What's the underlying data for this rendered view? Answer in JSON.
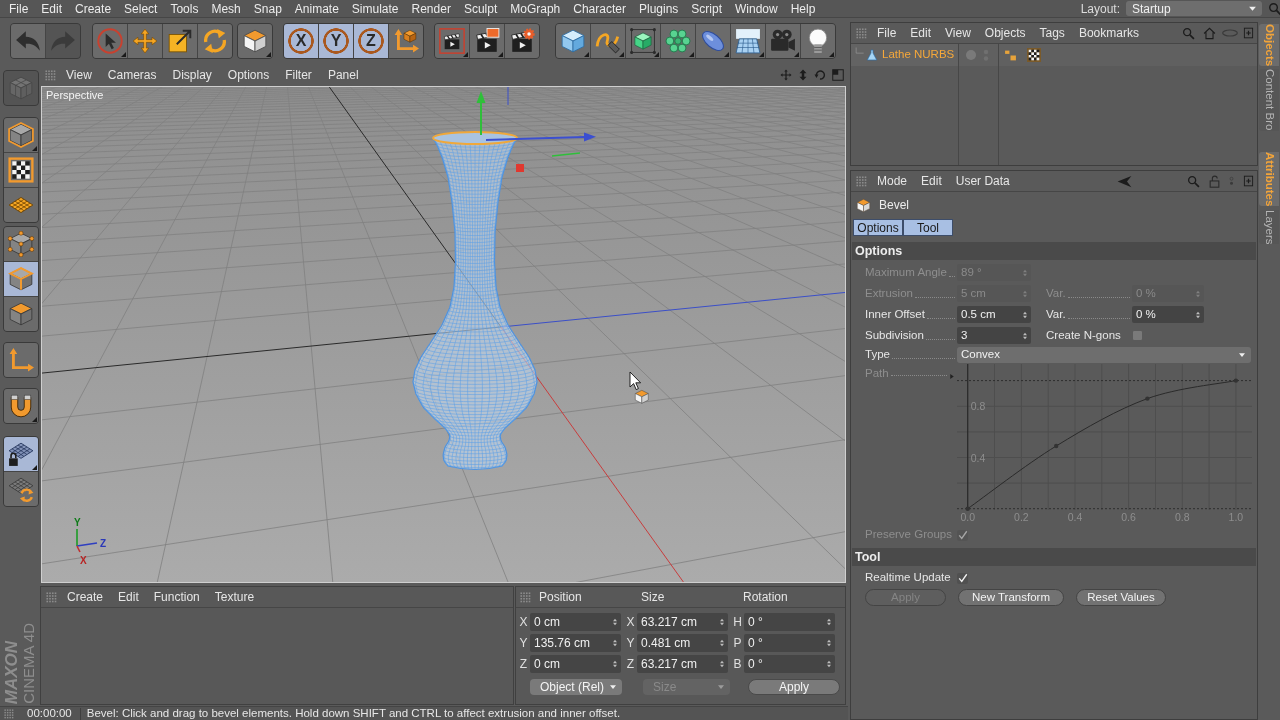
{
  "menu_bar": {
    "items": [
      "File",
      "Edit",
      "Create",
      "Select",
      "Tools",
      "Mesh",
      "Snap",
      "Animate",
      "Simulate",
      "Render",
      "Sculpt",
      "MoGraph",
      "Character",
      "Plugins",
      "Script",
      "Window",
      "Help"
    ],
    "layout_label": "Layout:",
    "layout_value": "Startup"
  },
  "toolbar": {
    "groups": [
      [
        {
          "kind": "undo",
          "on": false,
          "disabled": false,
          "submenu": false
        },
        {
          "kind": "redo",
          "on": false,
          "disabled": true,
          "submenu": false
        }
      ],
      [
        {
          "kind": "live-selection",
          "on": false,
          "disabled": false,
          "submenu": true
        },
        {
          "kind": "move",
          "on": false,
          "disabled": false,
          "submenu": false
        },
        {
          "kind": "scale",
          "on": false,
          "disabled": false,
          "submenu": false
        },
        {
          "kind": "rotate",
          "on": false,
          "disabled": false,
          "submenu": false
        }
      ],
      [
        {
          "kind": "last-tool",
          "on": false,
          "disabled": false,
          "submenu": true
        }
      ],
      [
        {
          "kind": "axis-lock",
          "label": "X",
          "on": true,
          "disabled": false,
          "submenu": false
        },
        {
          "kind": "axis-lock",
          "label": "Y",
          "on": true,
          "disabled": false,
          "submenu": false
        },
        {
          "kind": "axis-lock",
          "label": "Z",
          "on": true,
          "disabled": false,
          "submenu": false
        },
        {
          "kind": "coordinate-system",
          "on": false,
          "disabled": false,
          "submenu": false
        }
      ],
      [
        {
          "kind": "render-view",
          "on": false,
          "disabled": false,
          "submenu": true
        },
        {
          "kind": "render-viewer",
          "on": false,
          "disabled": false,
          "submenu": true
        },
        {
          "kind": "render-settings",
          "on": false,
          "disabled": false,
          "submenu": false
        }
      ],
      [
        {
          "kind": "cube",
          "on": false,
          "disabled": false,
          "submenu": true
        },
        {
          "kind": "pen",
          "on": false,
          "disabled": false,
          "submenu": true
        },
        {
          "kind": "subdivision",
          "on": false,
          "disabled": false,
          "submenu": true
        },
        {
          "kind": "array",
          "on": false,
          "disabled": false,
          "submenu": true
        },
        {
          "kind": "deformer",
          "on": false,
          "disabled": false,
          "submenu": true
        },
        {
          "kind": "floor",
          "on": false,
          "disabled": false,
          "submenu": true
        },
        {
          "kind": "camera",
          "on": false,
          "disabled": false,
          "submenu": true
        },
        {
          "kind": "light",
          "on": false,
          "disabled": false,
          "submenu": true
        }
      ]
    ]
  },
  "mode_toolbar": {
    "groups": [
      [
        {
          "kind": "make-editable",
          "on": false,
          "disabled": true,
          "submenu": false
        }
      ],
      [
        {
          "kind": "model",
          "on": false,
          "disabled": false,
          "submenu": true
        },
        {
          "kind": "texture",
          "on": false,
          "disabled": false,
          "submenu": false
        },
        {
          "kind": "workplane",
          "on": false,
          "disabled": false,
          "submenu": false
        }
      ],
      [
        {
          "kind": "points",
          "on": false,
          "disabled": false,
          "submenu": false
        },
        {
          "kind": "edges",
          "on": true,
          "disabled": false,
          "submenu": false
        },
        {
          "kind": "polygons",
          "on": false,
          "disabled": false,
          "submenu": false
        }
      ],
      [
        {
          "kind": "axis",
          "on": false,
          "disabled": false,
          "submenu": false
        }
      ],
      [
        {
          "kind": "snap",
          "on": false,
          "disabled": false,
          "submenu": true
        }
      ],
      [
        {
          "kind": "locked-workplane",
          "on": true,
          "disabled": false,
          "submenu": true
        },
        {
          "kind": "planar-workplane",
          "on": false,
          "disabled": false,
          "submenu": false
        }
      ]
    ]
  },
  "viewport": {
    "menu": [
      "View",
      "Cameras",
      "Display",
      "Options",
      "Filter",
      "Panel"
    ],
    "camera_label": "Perspective",
    "axis_labels": [
      "Y",
      "Z",
      "X"
    ]
  },
  "brand": {
    "wordmark": "MAXON",
    "product": "CINEMA 4D"
  },
  "material_manager": {
    "menu": [
      "Create",
      "Edit",
      "Function",
      "Texture"
    ]
  },
  "coordinates": {
    "columns": [
      "Position",
      "Size",
      "Rotation"
    ],
    "rows": [
      [
        {
          "axis": "X",
          "value": "0 cm"
        },
        {
          "axis": "X",
          "value": "63.217 cm"
        },
        {
          "axis": "H",
          "value": "0 °"
        }
      ],
      [
        {
          "axis": "Y",
          "value": "135.76 cm"
        },
        {
          "axis": "Y",
          "value": "0.481 cm"
        },
        {
          "axis": "P",
          "value": "0 °"
        }
      ],
      [
        {
          "axis": "Z",
          "value": "0 cm"
        },
        {
          "axis": "Z",
          "value": "63.217 cm"
        },
        {
          "axis": "B",
          "value": "0 °"
        }
      ]
    ],
    "controls": [
      {
        "kind": "dropdown",
        "value": "Object (Rel)",
        "disabled": false
      },
      {
        "kind": "dropdown",
        "value": "Size",
        "disabled": true
      },
      {
        "kind": "button",
        "label": "Apply",
        "disabled": false
      }
    ]
  },
  "status_bar": {
    "time": "00:00:00",
    "message": "Bevel: Click and drag to bevel elements. Hold down SHIFT and CTRL to affect extrusion and inner offset."
  },
  "object_manager": {
    "menu": [
      "File",
      "Edit",
      "View",
      "Objects",
      "Tags",
      "Bookmarks"
    ],
    "objects": [
      {
        "name": "Lathe NURBS",
        "selected": true
      }
    ]
  },
  "attributes": {
    "menu": [
      "Mode",
      "Edit",
      "User Data"
    ],
    "title": "Bevel",
    "tabs": [
      {
        "label": "Options",
        "selected": true
      },
      {
        "label": "Tool",
        "selected": true
      }
    ],
    "sections": [
      {
        "title": "Options",
        "rows": [
          {
            "cells": [
              {
                "kind": "number",
                "label": "Maximum Angle",
                "value": "89 °",
                "disabled": true
              }
            ]
          },
          {
            "cells": [
              {
                "kind": "number",
                "label": "Extrusion",
                "value": "5 cm",
                "disabled": true
              },
              {
                "kind": "number",
                "label": "Var.",
                "value": "0 %",
                "disabled": true
              }
            ]
          },
          {
            "cells": [
              {
                "kind": "number",
                "label": "Inner Offset",
                "value": "0.5 cm",
                "disabled": false
              },
              {
                "kind": "number",
                "label": "Var.",
                "value": "0 %",
                "disabled": false
              }
            ]
          },
          {
            "cells": [
              {
                "kind": "number",
                "label": "Subdivision",
                "value": "3",
                "disabled": false
              },
              {
                "kind": "checkbox",
                "label": "Create N-gons",
                "checked": false,
                "disabled": false
              }
            ]
          },
          {
            "cells": [
              {
                "kind": "dropdown",
                "label": "Type",
                "value": "Convex",
                "disabled": false
              }
            ]
          },
          {
            "cells": [
              {
                "kind": "curve",
                "label": "Path",
                "disabled": true,
                "chart_data": {
                  "type": "line",
                  "x": [
                    0,
                    0.33,
                    0.67,
                    1.0
                  ],
                  "values": [
                    0,
                    0.49,
                    0.86,
                    1.0
                  ],
                  "xlim": [
                    -0.04,
                    1.06
                  ],
                  "ylim": [
                    -0.01,
                    1.13
                  ],
                  "xticks": [
                    {
                      "value": 0,
                      "label": "0.0"
                    },
                    {
                      "value": 0.2,
                      "label": "0.2"
                    },
                    {
                      "value": 0.4,
                      "label": "0.4"
                    },
                    {
                      "value": 0.6,
                      "label": "0.6"
                    },
                    {
                      "value": 0.8,
                      "label": "0.8"
                    },
                    {
                      "value": 1.0,
                      "label": "1.0"
                    }
                  ],
                  "yticks": [
                    {
                      "value": 0.4,
                      "label": "0.4"
                    },
                    {
                      "value": 0.8,
                      "label": "0.8"
                    }
                  ],
                  "grid": true,
                  "ref_lines": [
                    {
                      "axis": "y",
                      "value": 0
                    },
                    {
                      "axis": "y",
                      "value": 1
                    }
                  ]
                }
              }
            ]
          },
          {
            "cells": [
              {
                "kind": "checkbox",
                "label": "Preserve Groups",
                "checked": true,
                "disabled": true
              }
            ]
          }
        ]
      },
      {
        "title": "Tool",
        "rows": [
          {
            "cells": [
              {
                "kind": "checkbox",
                "label": "Realtime Update",
                "checked": true,
                "disabled": false
              }
            ]
          },
          {
            "cells": [
              {
                "kind": "button",
                "label": "Apply",
                "disabled": true
              },
              {
                "kind": "button",
                "label": "New Transform",
                "disabled": false
              },
              {
                "kind": "button",
                "label": "Reset Values",
                "disabled": false
              }
            ]
          }
        ]
      }
    ]
  },
  "side_tabs": [
    {
      "label": "Objects",
      "selected": true
    },
    {
      "label": "Content Bro",
      "selected": false
    },
    {
      "label": "Attributes",
      "selected": true
    },
    {
      "label": "Layers",
      "selected": false
    }
  ]
}
